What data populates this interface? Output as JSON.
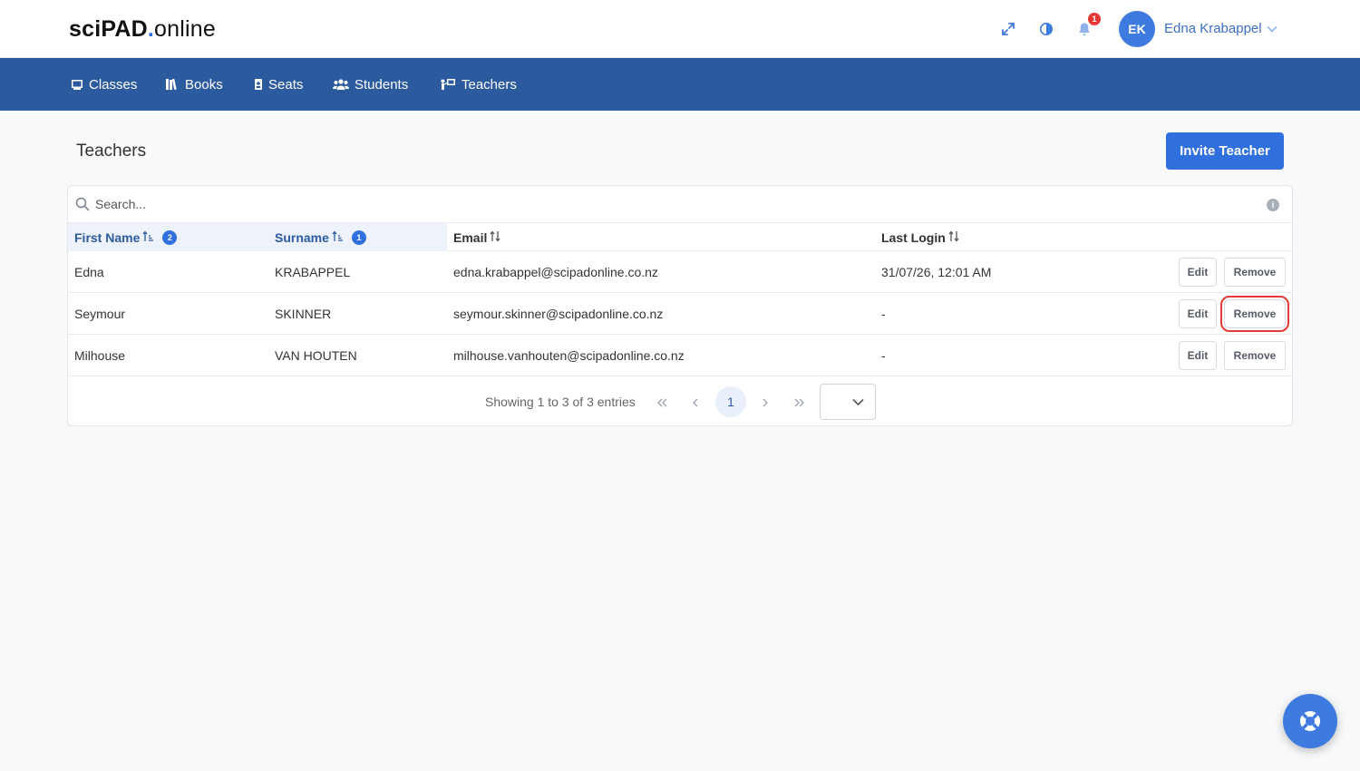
{
  "header": {
    "logo_bold": "sciPAD",
    "logo_dot": ".",
    "logo_thin": "online",
    "notification_count": "1",
    "user_initials": "EK",
    "user_name": "Edna Krabappel"
  },
  "nav": {
    "items": [
      {
        "label": "Classes",
        "icon": "classes-icon"
      },
      {
        "label": "Books",
        "icon": "books-icon"
      },
      {
        "label": "Seats",
        "icon": "seats-icon"
      },
      {
        "label": "Students",
        "icon": "students-icon"
      },
      {
        "label": "Teachers",
        "icon": "teachers-icon"
      }
    ]
  },
  "page": {
    "title": "Teachers",
    "invite_label": "Invite Teacher"
  },
  "table": {
    "search_placeholder": "Search...",
    "info_glyph": "i",
    "columns": [
      {
        "label": "First Name",
        "sort_order": "2"
      },
      {
        "label": "Surname",
        "sort_order": "1"
      },
      {
        "label": "Email"
      },
      {
        "label": "Last Login"
      }
    ],
    "rows": [
      {
        "first_name": "Edna",
        "surname": "KRABAPPEL",
        "email": "edna.krabappel@scipadonline.co.nz",
        "last_login": "31/07/26, 12:01 AM"
      },
      {
        "first_name": "Seymour",
        "surname": "SKINNER",
        "email": "seymour.skinner@scipadonline.co.nz",
        "last_login": "-"
      },
      {
        "first_name": "Milhouse",
        "surname": "VAN HOUTEN",
        "email": "milhouse.vanhouten@scipadonline.co.nz",
        "last_login": "-"
      }
    ],
    "edit_label": "Edit",
    "remove_label": "Remove",
    "highlighted_row": 1
  },
  "pagination": {
    "summary": "Showing 1 to 3 of 3 entries",
    "current_page": "1",
    "page_size": ""
  },
  "colors": {
    "brand_blue": "#2f6fde",
    "nav_blue": "#2c5a9e",
    "highlight_red": "#e53935"
  }
}
